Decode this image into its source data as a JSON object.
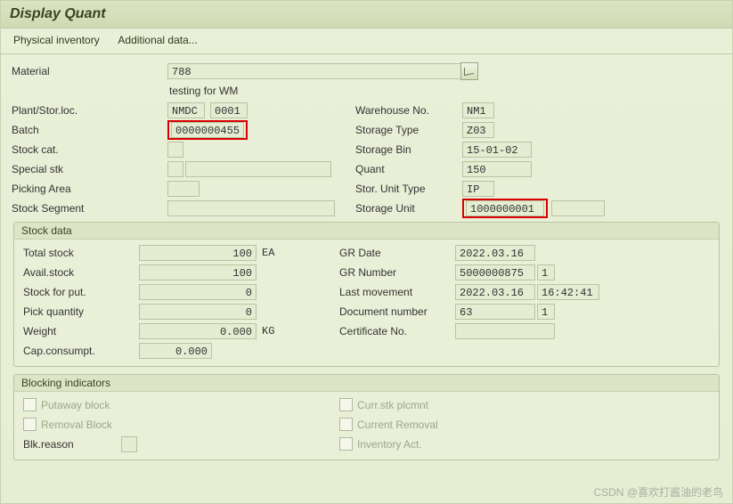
{
  "title": "Display Quant",
  "menu": {
    "phys": "Physical inventory",
    "addl": "Additional data..."
  },
  "top": {
    "material_lbl": "Material",
    "material": "788",
    "material_desc": "testing for WM",
    "plant_lbl": "Plant/Stor.loc.",
    "plant": "NMDC",
    "sloc": "0001",
    "batch_lbl": "Batch",
    "batch": "0000000455",
    "stockcat_lbl": "Stock cat.",
    "specialstk_lbl": "Special stk",
    "pickingarea_lbl": "Picking Area",
    "stockseg_lbl": "Stock Segment",
    "wh_lbl": "Warehouse No.",
    "wh": "NM1",
    "stype_lbl": "Storage Type",
    "stype": "Z03",
    "sbin_lbl": "Storage Bin",
    "sbin": "15-01-02",
    "quant_lbl": "Quant",
    "quant": "150",
    "sutype_lbl": "Stor. Unit Type",
    "sutype": "IP",
    "su_lbl": "Storage Unit",
    "su": "1000000001"
  },
  "stock": {
    "title": "Stock data",
    "total_lbl": "Total stock",
    "total": "100",
    "uom": "EA",
    "avail_lbl": "Avail.stock",
    "avail": "100",
    "forput_lbl": "Stock for put.",
    "forput": "0",
    "pickqty_lbl": "Pick quantity",
    "pickqty": "0",
    "weight_lbl": "Weight",
    "weight": "0.000",
    "wuom": "KG",
    "cap_lbl": "Cap.consumpt.",
    "cap": "0.000",
    "grdate_lbl": "GR Date",
    "grdate": "2022.03.16",
    "grnum_lbl": "GR Number",
    "grnum": "5000000875",
    "grpos": "1",
    "lastmv_lbl": "Last movement",
    "lastmv_d": "2022.03.16",
    "lastmv_t": "16:42:41",
    "docnum_lbl": "Document number",
    "docnum": "63",
    "docpos": "1",
    "cert_lbl": "Certificate No."
  },
  "block": {
    "title": "Blocking indicators",
    "putaway": "Putaway block",
    "removal": "Removal Block",
    "blkreason": "Blk.reason",
    "currstk": "Curr.stk plcmnt",
    "currrem": "Current Removal",
    "invact": "Inventory Act."
  },
  "watermark": "CSDN @喜欢打酱油的老鸟"
}
